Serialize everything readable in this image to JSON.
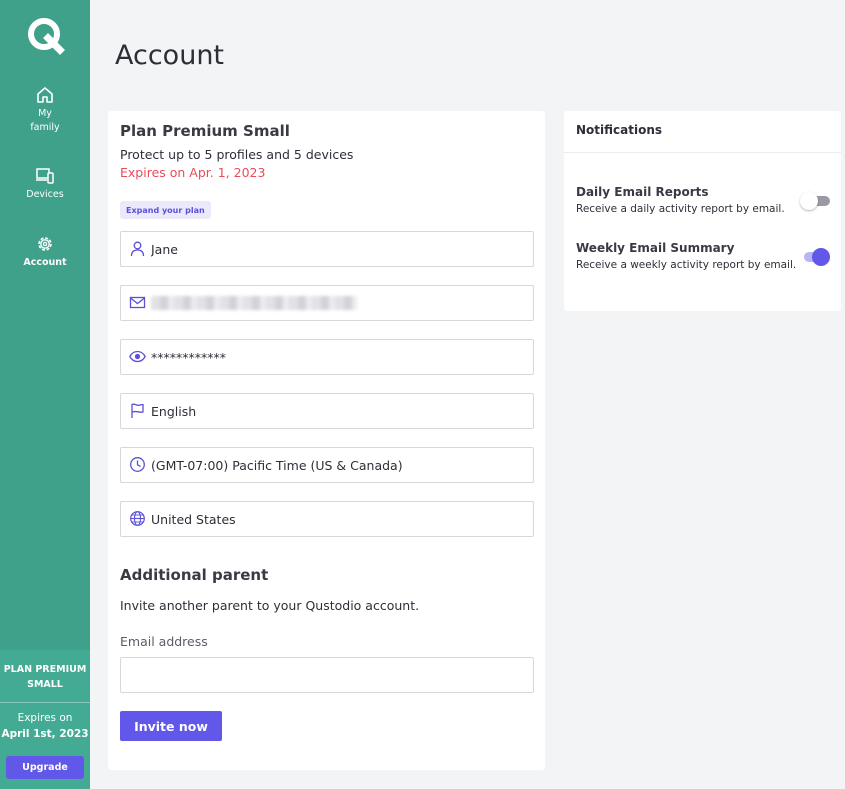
{
  "sidebar": {
    "items": [
      {
        "label": "My family",
        "icon": "home-icon"
      },
      {
        "label": "Devices",
        "icon": "devices-icon"
      },
      {
        "label": "Account",
        "icon": "gear-icon",
        "active": true
      }
    ],
    "plan_name": "PLAN PREMIUM SMALL",
    "expires_label": "Expires on",
    "expires_date": "April 1st, 2023",
    "upgrade_label": "Upgrade"
  },
  "page": {
    "title": "Account"
  },
  "account": {
    "plan_title": "Plan Premium Small",
    "plan_description": "Protect up to 5 profiles and 5 devices",
    "plan_expiry": "Expires on Apr. 1, 2023",
    "expand_label": "Expand your plan",
    "fields": {
      "name": "Jane",
      "password": "************",
      "language": "English",
      "timezone": "(GMT-07:00) Pacific Time (US & Canada)",
      "country": "United States"
    }
  },
  "additional_parent": {
    "title": "Additional parent",
    "description": "Invite another parent to your Qustodio account.",
    "email_label": "Email address",
    "email_value": "",
    "invite_label": "Invite now"
  },
  "notifications": {
    "header": "Notifications",
    "items": [
      {
        "title": "Daily Email Reports",
        "description": "Receive a daily activity report by email.",
        "enabled": false
      },
      {
        "title": "Weekly Email Summary",
        "description": "Receive a weekly activity report by email.",
        "enabled": true
      }
    ]
  },
  "colors": {
    "sidebar": "#3fa18a",
    "accent": "#6157e8",
    "expiry": "#e74c5a"
  }
}
